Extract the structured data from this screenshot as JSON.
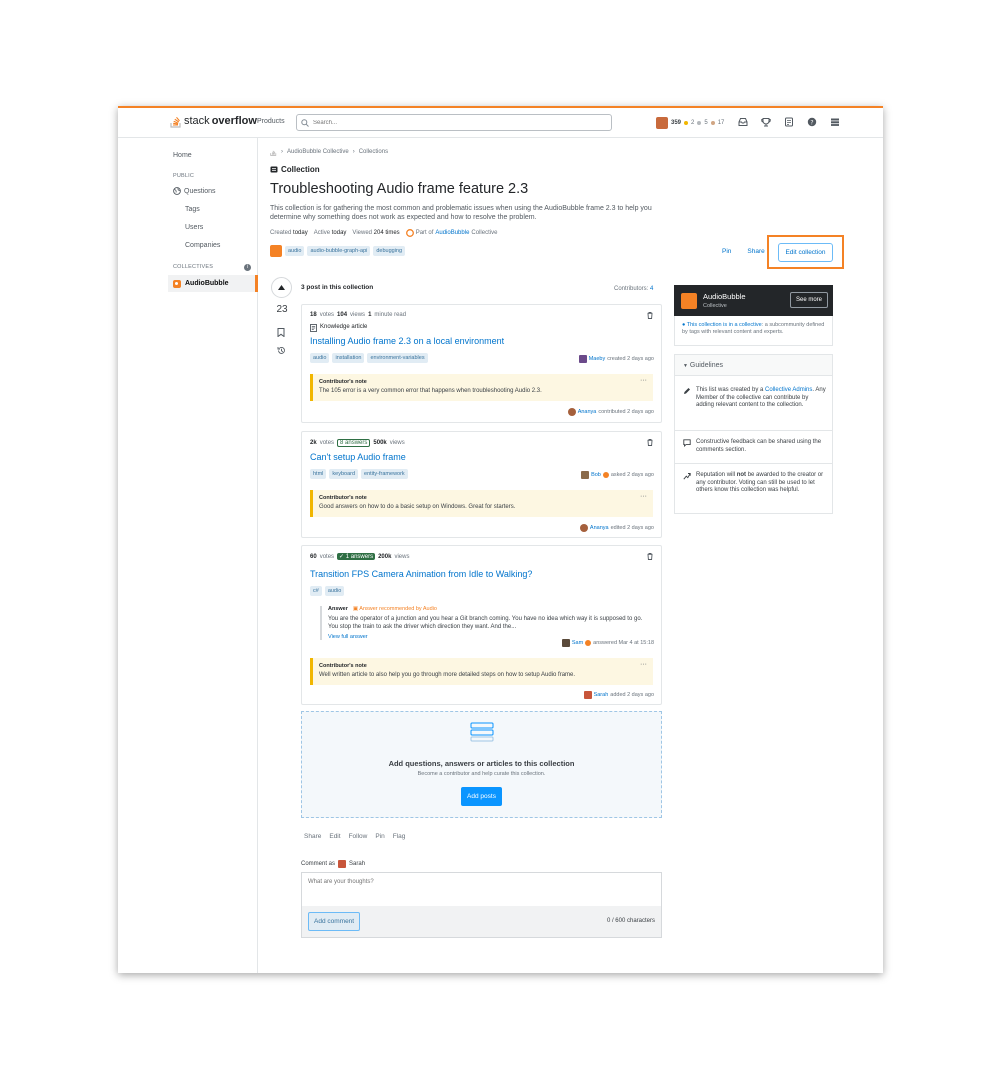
{
  "topbar": {
    "logo_light": "stack",
    "logo_bold": "overflow",
    "products": "Products",
    "search_placeholder": "Search...",
    "reputation": "359",
    "gold": "2",
    "silver": "5",
    "bronze": "17"
  },
  "nav": {
    "home": "Home",
    "public": "PUBLIC",
    "questions": "Questions",
    "tags": "Tags",
    "users": "Users",
    "companies": "Companies",
    "collectives": "COLLECTIVES",
    "active": "AudioBubble"
  },
  "breadcrumb": [
    "AudioBubble Collective",
    "Collections"
  ],
  "collection": {
    "label": "Collection",
    "title": "Troubleshooting Audio frame feature 2.3",
    "description": "This collection is for gathering the most common and problematic issues when using the AudioBubble frame 2.3 to help you determine why something does not work as expected and how to resolve the problem.",
    "meta": {
      "created_label": "Created",
      "created": "today",
      "active_label": "Active",
      "active": "today",
      "viewed_label": "Viewed",
      "viewed": "204 times",
      "part_of": "Part of",
      "collective_link": "AudioBubble",
      "collective_suffix": "Collective"
    },
    "tags": [
      "audio",
      "audio-bubble-graph-api",
      "debugging"
    ],
    "pin": "Pin",
    "share": "Share",
    "edit": "Edit collection",
    "score": "23",
    "count_label": "3 post in this collection",
    "contributors_label": "Contributors:",
    "contributors_count": "4"
  },
  "posts": [
    {
      "votes": "18",
      "votes_label": "votes",
      "views": "104",
      "views_label": "views",
      "read": "1",
      "read_label": "minute read",
      "kind": "Knowledge article",
      "title": "Installing Audio frame 2.3 on a local environment",
      "tags": [
        "audio",
        "installation",
        "environment-variables"
      ],
      "owner": "Maeby",
      "owner_action": "created 2 days ago",
      "note_title": "Contributor's note",
      "note": "The 105 error is a very common error that happens when troubleshooting Audio 2.3.",
      "note_by": "Ananya",
      "note_action": "contributed 2 days ago"
    },
    {
      "votes": "2k",
      "votes_label": "votes",
      "answers": "8 answers",
      "views": "500k",
      "views_label": "views",
      "title": "Can't setup Audio frame",
      "tags": [
        "html",
        "keyboard",
        "entity-framework"
      ],
      "owner": "Bob",
      "owner_action": "asked 2 days ago",
      "note_title": "Contributor's note",
      "note": "Good answers on how to do a basic setup on Windows. Great for starters.",
      "note_by": "Ananya",
      "note_action": "edited 2 days ago"
    },
    {
      "votes": "60",
      "votes_label": "votes",
      "answers": "✓ 1 answers",
      "views": "200k",
      "views_label": "views",
      "title": "Transition FPS Camera Animation from Idle to Walking?",
      "tags": [
        "c#",
        "audio"
      ],
      "answer_label": "Answer",
      "answer_rec": "Answer recommended by Audio",
      "answer_body": "You are the operator of a junction and you hear a Git branch coming. You have no idea which way it is supposed to go. You stop the train to ask the driver which direction they want. And the...",
      "view_full": "View full answer",
      "answer_by": "Sam",
      "answer_action": "answered Mar 4 at 15:18",
      "note_title": "Contributor's note",
      "note": "Well written article to also help you go through more detailed steps on how to setup Audio frame.",
      "note_by": "Sarah",
      "note_action": "added 2 days ago"
    }
  ],
  "empty": {
    "heading": "Add questions, answers or articles to this collection",
    "sub": "Become a contributor and help curate this collection.",
    "button": "Add posts"
  },
  "actions": [
    "Share",
    "Edit",
    "Follow",
    "Pin",
    "Flag"
  ],
  "comment": {
    "as_label": "Comment as",
    "user": "Sarah",
    "placeholder": "What are your thoughts?",
    "button": "Add comment",
    "count": "0 / 600 characters"
  },
  "sidebar": {
    "name": "AudioBubble",
    "sub": "Collective",
    "see_more": "See more",
    "info_link": "This collection is in a collective",
    "info_text": ": a subcommunity defined by tags with relevant content and experts.",
    "guidelines": "Guidelines",
    "g1_a": "This list was created by a",
    "g1_link": "Collective Admins",
    "g1_b": ". Any Member of the collective can contribute by adding relevant content to the collection.",
    "g2": "Constructive feedback can be shared using the comments section.",
    "g3_a": "Reputation will",
    "g3_bold": "not",
    "g3_b": "be awarded to the creator or any contributor. Voting can still be used to let others know this collection was helpful."
  },
  "colors": {
    "accent": "#f48225",
    "link": "#0074cc",
    "answer_green": "#2f6f44"
  }
}
